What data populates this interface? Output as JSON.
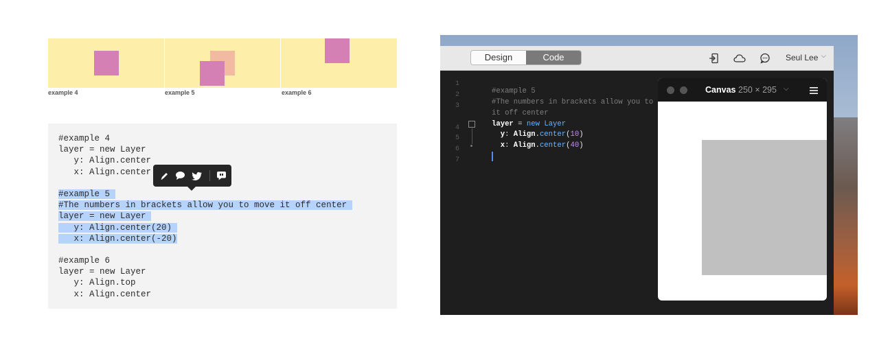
{
  "examples": [
    {
      "caption": "example 4"
    },
    {
      "caption": "example 5"
    },
    {
      "caption": "example 6"
    }
  ],
  "colors": {
    "panel_bg": "#fdeeaa",
    "layer_pink": "#d580b5",
    "layer_peach": "#f2bba1",
    "selection": "#b6d3fb",
    "canvas_layer": "#c0c0c0"
  },
  "code_block": {
    "lines": [
      {
        "text": "#example 4",
        "sel": false
      },
      {
        "text": "layer = new Layer",
        "sel": false
      },
      {
        "text": "   y: Align.center",
        "sel": false
      },
      {
        "text": "   x: Align.center",
        "sel": false
      },
      {
        "text": "",
        "sel": false
      },
      {
        "text": "#example 5 ",
        "sel": true
      },
      {
        "text": "#The numbers in brackets allow you to move it off center ",
        "sel": true
      },
      {
        "text": "layer = new Layer ",
        "sel": true
      },
      {
        "text": "   y: Align.center(20) ",
        "sel": true
      },
      {
        "text": "   x: Align.center(-20)",
        "sel": true
      },
      {
        "text": "",
        "sel": false
      },
      {
        "text": "#example 6",
        "sel": false
      },
      {
        "text": "layer = new Layer",
        "sel": false
      },
      {
        "text": "   y: Align.top",
        "sel": false
      },
      {
        "text": "   x: Align.center",
        "sel": false
      }
    ]
  },
  "selection_toolbar": {
    "icons": [
      "pencil-icon",
      "speech-bubble-icon",
      "twitter-bird-icon",
      "comment-quote-icon"
    ]
  },
  "app": {
    "tabs": [
      {
        "label": "Design",
        "active": false
      },
      {
        "label": "Code",
        "active": true
      }
    ],
    "toolbar_icons": [
      "share-exit-icon",
      "cloud-icon",
      "chat-bubble-icon"
    ],
    "user": {
      "name": "Seul Lee"
    },
    "editor": {
      "line_numbers": [
        "1",
        "2",
        "3",
        "",
        "4",
        "5",
        "6",
        "7"
      ],
      "lines": [
        "",
        "#example 5",
        "#The numbers in brackets allow you to mov",
        "it off center",
        "layer = new Layer",
        "  y: Align.center(10)",
        "  x: Align.center(40)",
        ""
      ]
    },
    "canvas": {
      "title": "Canvas",
      "size": "250 × 295"
    }
  }
}
